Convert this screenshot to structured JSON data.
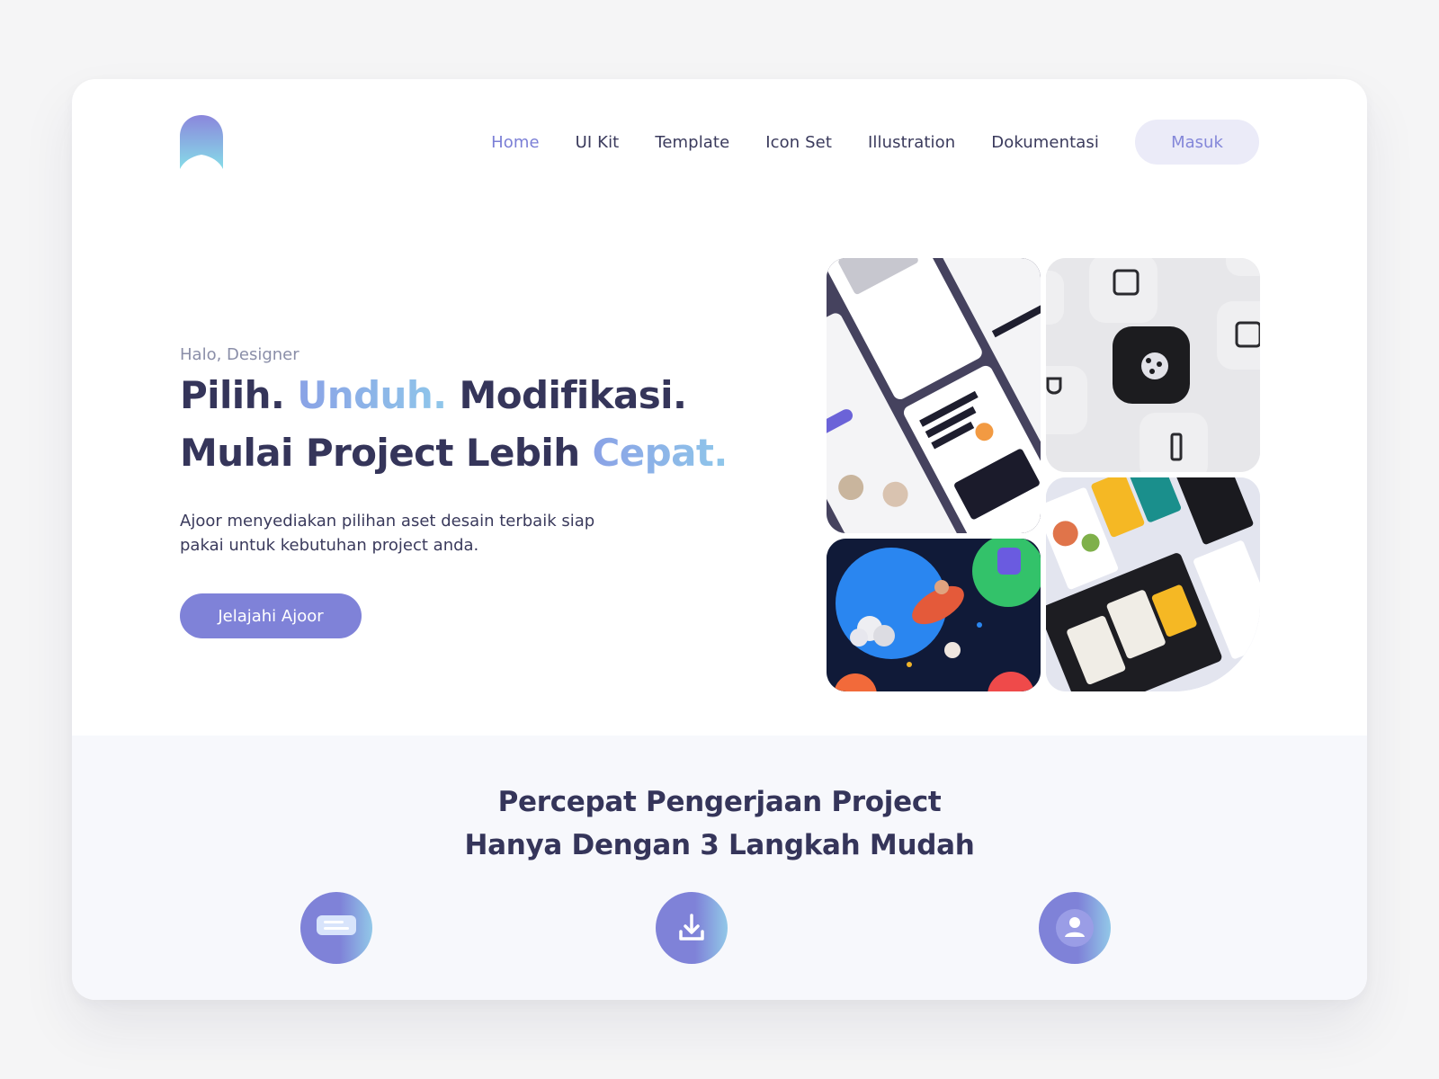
{
  "nav": {
    "items": [
      {
        "label": "Home",
        "active": true
      },
      {
        "label": "UI Kit",
        "active": false
      },
      {
        "label": "Template",
        "active": false
      },
      {
        "label": "Icon Set",
        "active": false
      },
      {
        "label": "Illustration",
        "active": false
      },
      {
        "label": "Dokumentasi",
        "active": false
      }
    ],
    "login_label": "Masuk"
  },
  "hero": {
    "eyebrow": "Halo, Designer",
    "line1_a": "Pilih.",
    "line1_b": "Unduh.",
    "line1_c": "Modifikasi.",
    "line2_a": "Mulai Project Lebih",
    "line2_b": "Cepat.",
    "description": "Ajoor menyediakan pilihan aset desain terbaik siap pakai untuk kebutuhan project anda.",
    "cta_label": "Jelajahi Ajoor"
  },
  "steps": {
    "title_line1": "Percepat Pengerjaan Project",
    "title_line2": "Hanya Dengan 3 Langkah Mudah",
    "icons": [
      "chat-icon",
      "download-icon",
      "user-icon"
    ]
  },
  "colors": {
    "accent": "#7f82d8",
    "heading": "#35355a",
    "highlight": "#8fb4ea",
    "section_bg": "#f7f8fc"
  }
}
